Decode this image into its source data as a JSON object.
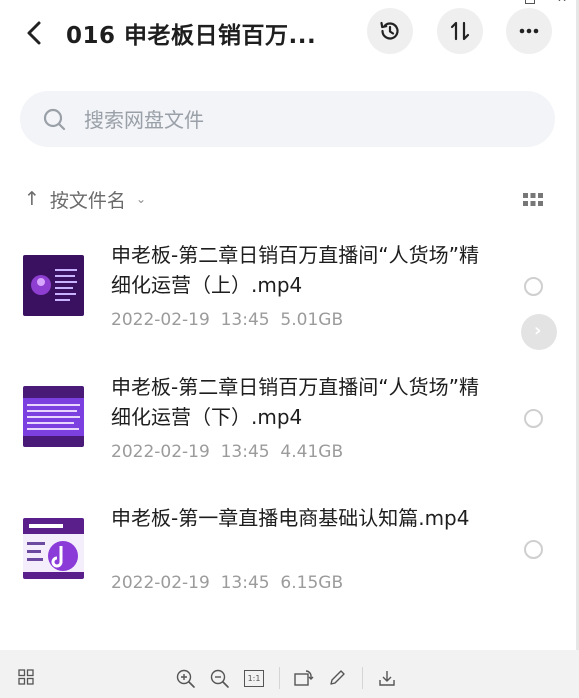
{
  "window": {
    "close_glyph": "✕"
  },
  "header": {
    "title": "016 申老板日销百万..."
  },
  "search": {
    "placeholder": "搜索网盘文件"
  },
  "sort": {
    "arrow": "↑",
    "label": "按文件名",
    "chevron": "⌄"
  },
  "files": [
    {
      "name": "申老板-第二章日销百万直播间“人货场”精细化运营（上）.mp4",
      "date": "2022-02-19",
      "time": "13:45",
      "size": "5.01GB"
    },
    {
      "name": "申老板-第二章日销百万直播间“人货场”精细化运营（下）.mp4",
      "date": "2022-02-19",
      "time": "13:45",
      "size": "4.41GB"
    },
    {
      "name": "申老板-第一章直播电商基础认知篇.mp4",
      "date": "2022-02-19",
      "time": "13:45",
      "size": "6.15GB"
    }
  ],
  "fab": {
    "glyph": "›"
  },
  "toolbar": {
    "actual_size_label": "1:1"
  },
  "colors": {
    "accent": "#1f1f1f",
    "muted": "#9b9b9b",
    "search_bg": "#f3f4f8",
    "thumb_purple": "#5a1f8a"
  }
}
